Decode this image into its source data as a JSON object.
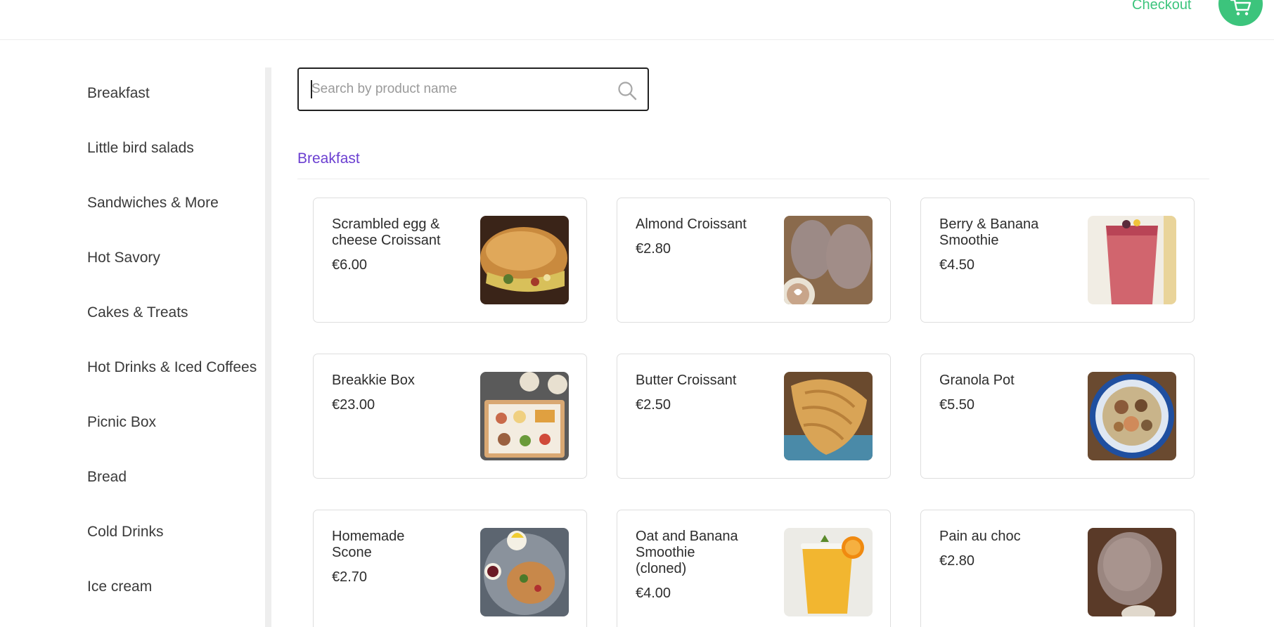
{
  "header": {
    "checkout_label": "Checkout",
    "cart_icon": "cart-icon",
    "accent_color": "#3cc47c"
  },
  "sidebar": {
    "categories": [
      {
        "label": "Breakfast"
      },
      {
        "label": "Little bird salads"
      },
      {
        "label": "Sandwiches & More"
      },
      {
        "label": "Hot Savory"
      },
      {
        "label": "Cakes & Treats"
      },
      {
        "label": "Hot Drinks & Iced Coffees"
      },
      {
        "label": "Picnic Box"
      },
      {
        "label": "Bread"
      },
      {
        "label": "Cold Drinks"
      },
      {
        "label": "Ice cream"
      }
    ]
  },
  "search": {
    "placeholder": "Search by product name",
    "value": "",
    "icon": "search-icon"
  },
  "section": {
    "title": "Breakfast",
    "title_color": "#6b3fd1"
  },
  "products": [
    {
      "name": "Scrambled egg & cheese Croissant",
      "price": "€6.00"
    },
    {
      "name": "Almond Croissant",
      "price": "€2.80"
    },
    {
      "name": "Berry & Banana Smoothie",
      "price": "€4.50"
    },
    {
      "name": "Breakkie Box",
      "price": "€23.00"
    },
    {
      "name": "Butter Croissant",
      "price": "€2.50"
    },
    {
      "name": "Granola Pot",
      "price": "€5.50"
    },
    {
      "name": "Homemade Scone",
      "price": "€2.70"
    },
    {
      "name": "Oat and Banana Smoothie (cloned)",
      "price": "€4.00"
    },
    {
      "name": "Pain au choc",
      "price": "€2.80"
    }
  ]
}
